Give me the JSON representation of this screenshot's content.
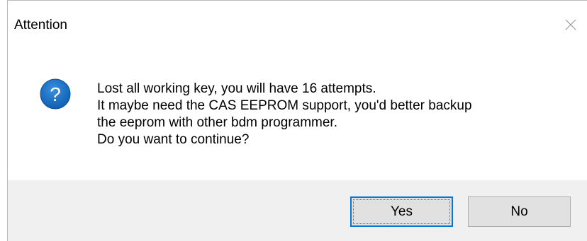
{
  "dialog": {
    "title": "Attention",
    "close_icon": "close-icon",
    "question_icon": "question-icon",
    "accent_color": "#0078d7",
    "message_lines": [
      "Lost all working key, you will have 16 attempts.",
      "It maybe need the CAS EEPROM support, you'd better backup",
      "the eeprom with other bdm programmer.",
      "Do you want to continue?"
    ],
    "buttons": {
      "yes_label": "Yes",
      "no_label": "No"
    }
  }
}
